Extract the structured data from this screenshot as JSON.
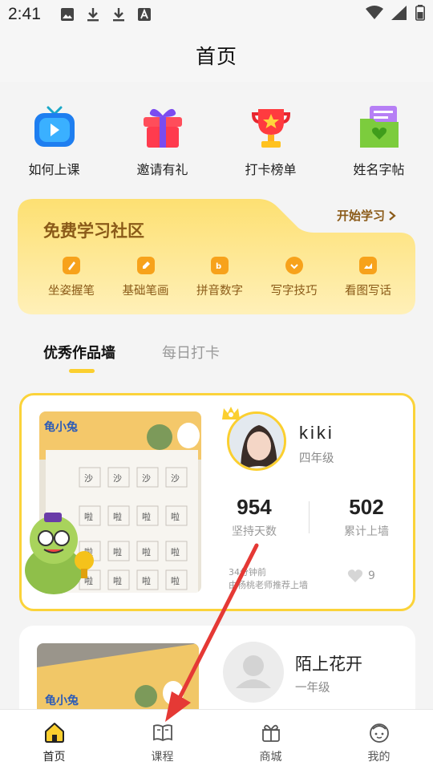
{
  "status_bar": {
    "time": "2:41"
  },
  "header": {
    "title": "首页"
  },
  "quick_links": [
    {
      "label": "如何上课",
      "icon": "tv-icon"
    },
    {
      "label": "邀请有礼",
      "icon": "gift-icon"
    },
    {
      "label": "打卡榜单",
      "icon": "trophy-icon"
    },
    {
      "label": "姓名字帖",
      "icon": "copybook-icon"
    }
  ],
  "community": {
    "title": "免费学习社区",
    "start_label": "开始学习",
    "items": [
      {
        "label": "坐姿握笔",
        "icon": "pencil-icon"
      },
      {
        "label": "基础笔画",
        "icon": "edit-icon"
      },
      {
        "label": "拼音数字",
        "icon": "pinyin-icon"
      },
      {
        "label": "写字技巧",
        "icon": "tips-icon"
      },
      {
        "label": "看图写话",
        "icon": "picture-icon"
      }
    ]
  },
  "tabs": [
    {
      "label": "优秀作品墙",
      "active": true
    },
    {
      "label": "每日打卡",
      "active": false
    }
  ],
  "works": [
    {
      "name": "kiki",
      "grade": "四年级",
      "days_value": "954",
      "days_label": "坚持天数",
      "wall_value": "502",
      "wall_label": "累计上墙",
      "time_ago": "34分钟前",
      "recommend": "由杨桃老师推荐上墙",
      "likes": "9"
    },
    {
      "name": "陌上花开",
      "grade": "一年级"
    }
  ],
  "bottom_nav": [
    {
      "label": "首页",
      "icon": "home-icon",
      "active": true
    },
    {
      "label": "课程",
      "icon": "book-icon",
      "active": false
    },
    {
      "label": "商城",
      "icon": "shop-icon",
      "active": false
    },
    {
      "label": "我的",
      "icon": "profile-icon",
      "active": false
    }
  ],
  "colors": {
    "accent": "#fbcf2f",
    "community_bg": "#fde387",
    "community_text": "#8a5a18"
  }
}
